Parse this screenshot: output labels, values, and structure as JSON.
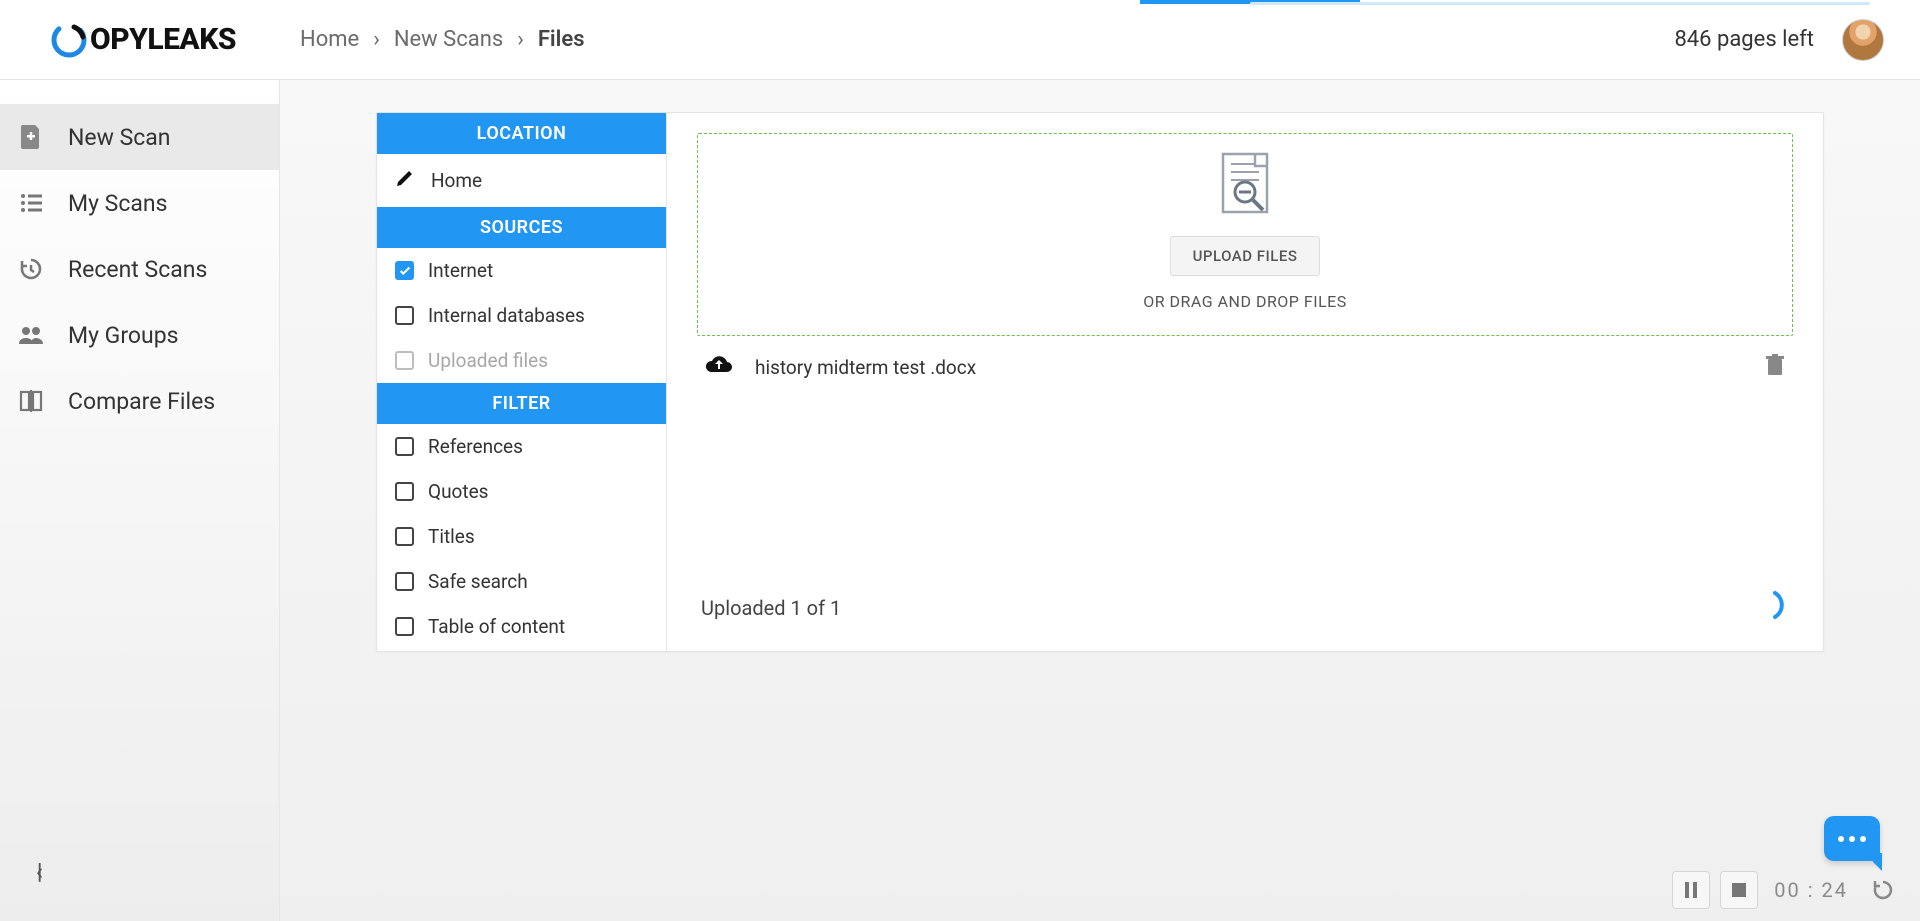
{
  "logo_text": "OPYLEAKS",
  "breadcrumb": {
    "home": "Home",
    "newscans": "New Scans",
    "current": "Files"
  },
  "pages_left": "846 pages left",
  "sidebar": {
    "items": [
      {
        "label": "New Scan"
      },
      {
        "label": "My Scans"
      },
      {
        "label": "Recent Scans"
      },
      {
        "label": "My Groups"
      },
      {
        "label": "Compare Files"
      }
    ]
  },
  "panel": {
    "location_header": "LOCATION",
    "home_label": "Home",
    "sources_header": "SOURCES",
    "sources": [
      {
        "label": "Internet",
        "checked": true,
        "disabled": false
      },
      {
        "label": "Internal databases",
        "checked": false,
        "disabled": false
      },
      {
        "label": "Uploaded files",
        "checked": false,
        "disabled": true
      }
    ],
    "filter_header": "FILTER",
    "filters": [
      {
        "label": "References"
      },
      {
        "label": "Quotes"
      },
      {
        "label": "Titles"
      },
      {
        "label": "Safe search"
      },
      {
        "label": "Table of content"
      }
    ]
  },
  "dropzone": {
    "upload_btn": "UPLOAD FILES",
    "or_drag": "OR DRAG AND DROP FILES"
  },
  "uploaded_file": {
    "name": "history midterm test .docx"
  },
  "uploaded_status": "Uploaded 1 of 1",
  "player": {
    "time": "00 : 24"
  }
}
